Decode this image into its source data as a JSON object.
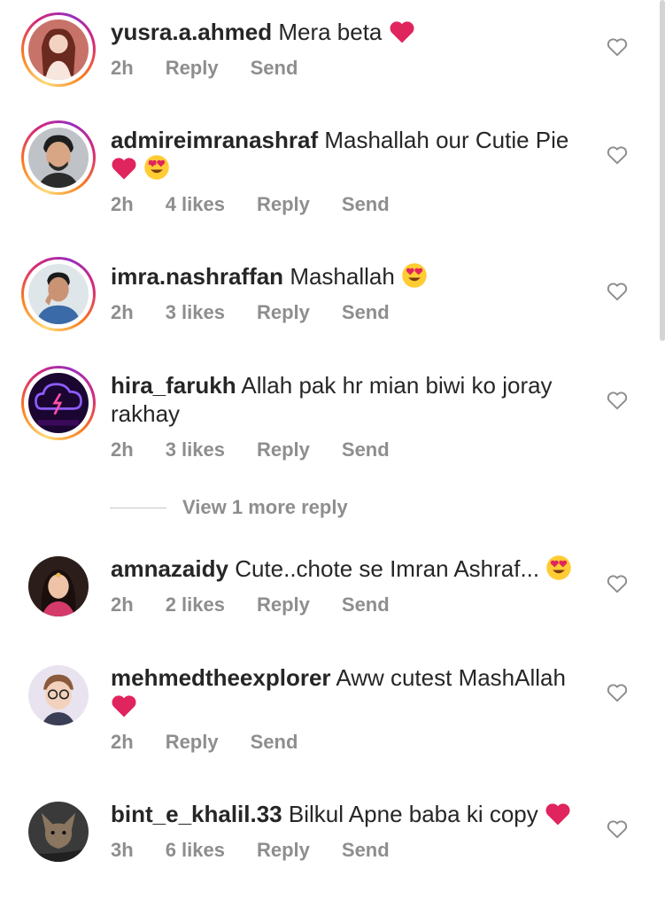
{
  "comments": [
    {
      "username": "yusra.a.ahmed",
      "text": "Mera beta",
      "time": "2h",
      "likes": "",
      "reply": "Reply",
      "send": "Send"
    },
    {
      "username": "admireimranashraf",
      "text": "Mashallah our Cutie Pie",
      "time": "2h",
      "likes": "4 likes",
      "reply": "Reply",
      "send": "Send"
    },
    {
      "username": "imra.nashraffan",
      "text": "Mashallah",
      "time": "2h",
      "likes": "3 likes",
      "reply": "Reply",
      "send": "Send"
    },
    {
      "username": "hira_farukh",
      "text": "Allah pak hr mian biwi ko joray rakhay",
      "time": "2h",
      "likes": "3 likes",
      "reply": "Reply",
      "send": "Send"
    },
    {
      "username": "amnazaidy",
      "text": "Cute..chote se Imran Ashraf...",
      "time": "2h",
      "likes": "2 likes",
      "reply": "Reply",
      "send": "Send"
    },
    {
      "username": "mehmedtheexplorer",
      "text": "Aww cutest MashAllah",
      "time": "2h",
      "likes": "",
      "reply": "Reply",
      "send": "Send"
    },
    {
      "username": "bint_e_khalil.33",
      "text": "Bilkul Apne baba ki copy",
      "time": "3h",
      "likes": "6 likes",
      "reply": "Reply",
      "send": "Send"
    }
  ],
  "view_more": "View 1 more reply",
  "colors": {
    "text": "#262626",
    "muted": "#8e8e8e",
    "heart": "#e0245e"
  }
}
